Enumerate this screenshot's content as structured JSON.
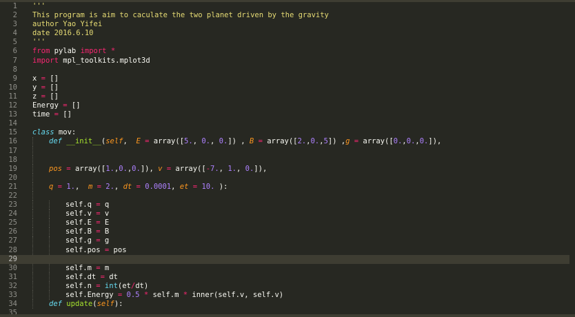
{
  "editor": {
    "theme_colors": {
      "background": "#272822",
      "text": "#f8f8f2",
      "string": "#e6db74",
      "keyword": "#f92672",
      "storage": "#66d9ef",
      "function_name": "#a6e22e",
      "parameter": "#fd971f",
      "number": "#ae81ff",
      "line_number": "#90908a",
      "current_line": "#3e3d32"
    },
    "current_line": 29,
    "lines": [
      {
        "n": "1",
        "tokens": [
          {
            "t": "'''",
            "c": "string"
          }
        ]
      },
      {
        "n": "2",
        "tokens": [
          {
            "t": "This program is aim to caculate the two planet driven by the gravity",
            "c": "string"
          }
        ]
      },
      {
        "n": "3",
        "tokens": [
          {
            "t": "author Yao Yifei",
            "c": "string"
          }
        ]
      },
      {
        "n": "4",
        "tokens": [
          {
            "t": "date 2016.6.10",
            "c": "string"
          }
        ]
      },
      {
        "n": "5",
        "tokens": [
          {
            "t": "'''",
            "c": "string"
          }
        ]
      },
      {
        "n": "6",
        "tokens": [
          {
            "t": "from",
            "c": "keyword"
          },
          {
            "t": " pylab ",
            "c": "name"
          },
          {
            "t": "import",
            "c": "keyword"
          },
          {
            "t": " ",
            "c": "name"
          },
          {
            "t": "*",
            "c": "op"
          }
        ]
      },
      {
        "n": "7",
        "tokens": [
          {
            "t": "import",
            "c": "keyword"
          },
          {
            "t": " mpl_toolkits.mplot3d",
            "c": "name"
          }
        ]
      },
      {
        "n": "8",
        "tokens": []
      },
      {
        "n": "9",
        "tokens": [
          {
            "t": "x ",
            "c": "name"
          },
          {
            "t": "=",
            "c": "op"
          },
          {
            "t": " []",
            "c": "name"
          }
        ]
      },
      {
        "n": "10",
        "tokens": [
          {
            "t": "y ",
            "c": "name"
          },
          {
            "t": "=",
            "c": "op"
          },
          {
            "t": " []",
            "c": "name"
          }
        ]
      },
      {
        "n": "11",
        "tokens": [
          {
            "t": "z ",
            "c": "name"
          },
          {
            "t": "=",
            "c": "op"
          },
          {
            "t": " []",
            "c": "name"
          }
        ]
      },
      {
        "n": "12",
        "tokens": [
          {
            "t": "Energy ",
            "c": "name"
          },
          {
            "t": "=",
            "c": "op"
          },
          {
            "t": " []",
            "c": "name"
          }
        ]
      },
      {
        "n": "13",
        "tokens": [
          {
            "t": "time ",
            "c": "name"
          },
          {
            "t": "=",
            "c": "op"
          },
          {
            "t": " []",
            "c": "name"
          }
        ]
      },
      {
        "n": "14",
        "tokens": []
      },
      {
        "n": "15",
        "tokens": [
          {
            "t": "class",
            "c": "storage"
          },
          {
            "t": " mov:",
            "c": "name"
          }
        ]
      },
      {
        "n": "16",
        "indent": 1,
        "tokens": [
          {
            "t": "def",
            "c": "storage"
          },
          {
            "t": " ",
            "c": "name"
          },
          {
            "t": "__init__",
            "c": "func"
          },
          {
            "t": "(",
            "c": "name"
          },
          {
            "t": "self",
            "c": "param"
          },
          {
            "t": ",  ",
            "c": "name"
          },
          {
            "t": "E",
            "c": "param"
          },
          {
            "t": " ",
            "c": "name"
          },
          {
            "t": "=",
            "c": "op"
          },
          {
            "t": " array([",
            "c": "name"
          },
          {
            "t": "5.",
            "c": "num"
          },
          {
            "t": ", ",
            "c": "name"
          },
          {
            "t": "0.",
            "c": "num"
          },
          {
            "t": ", ",
            "c": "name"
          },
          {
            "t": "0.",
            "c": "num"
          },
          {
            "t": "]) , ",
            "c": "name"
          },
          {
            "t": "B",
            "c": "param"
          },
          {
            "t": " ",
            "c": "name"
          },
          {
            "t": "=",
            "c": "op"
          },
          {
            "t": " array([",
            "c": "name"
          },
          {
            "t": "2.",
            "c": "num"
          },
          {
            "t": ",",
            "c": "name"
          },
          {
            "t": "0.",
            "c": "num"
          },
          {
            "t": ",",
            "c": "name"
          },
          {
            "t": "5",
            "c": "num"
          },
          {
            "t": "]) ,",
            "c": "name"
          },
          {
            "t": "g",
            "c": "param"
          },
          {
            "t": " ",
            "c": "name"
          },
          {
            "t": "=",
            "c": "op"
          },
          {
            "t": " array([",
            "c": "name"
          },
          {
            "t": "0.",
            "c": "num"
          },
          {
            "t": ",",
            "c": "name"
          },
          {
            "t": "0.",
            "c": "num"
          },
          {
            "t": ",",
            "c": "name"
          },
          {
            "t": "0.",
            "c": "num"
          },
          {
            "t": "]),",
            "c": "name"
          }
        ]
      },
      {
        "n": "17",
        "indent": 1,
        "tokens": []
      },
      {
        "n": "18",
        "indent": 1,
        "tokens": []
      },
      {
        "n": "19",
        "indent": 1,
        "tokens": [
          {
            "t": "pos",
            "c": "param"
          },
          {
            "t": " ",
            "c": "name"
          },
          {
            "t": "=",
            "c": "op"
          },
          {
            "t": " array([",
            "c": "name"
          },
          {
            "t": "1.",
            "c": "num"
          },
          {
            "t": ",",
            "c": "name"
          },
          {
            "t": "0.",
            "c": "num"
          },
          {
            "t": ",",
            "c": "name"
          },
          {
            "t": "0.",
            "c": "num"
          },
          {
            "t": "]), ",
            "c": "name"
          },
          {
            "t": "v",
            "c": "param"
          },
          {
            "t": " ",
            "c": "name"
          },
          {
            "t": "=",
            "c": "op"
          },
          {
            "t": " array([",
            "c": "name"
          },
          {
            "t": "-",
            "c": "op"
          },
          {
            "t": "7.",
            "c": "num"
          },
          {
            "t": ", ",
            "c": "name"
          },
          {
            "t": "1.",
            "c": "num"
          },
          {
            "t": ", ",
            "c": "name"
          },
          {
            "t": "0.",
            "c": "num"
          },
          {
            "t": "]),",
            "c": "name"
          }
        ]
      },
      {
        "n": "20",
        "indent": 1,
        "tokens": []
      },
      {
        "n": "21",
        "indent": 1,
        "tokens": [
          {
            "t": "q",
            "c": "param"
          },
          {
            "t": " ",
            "c": "name"
          },
          {
            "t": "=",
            "c": "op"
          },
          {
            "t": " ",
            "c": "name"
          },
          {
            "t": "1.",
            "c": "num"
          },
          {
            "t": ",  ",
            "c": "name"
          },
          {
            "t": "m",
            "c": "param"
          },
          {
            "t": " ",
            "c": "name"
          },
          {
            "t": "=",
            "c": "op"
          },
          {
            "t": " ",
            "c": "name"
          },
          {
            "t": "2.",
            "c": "num"
          },
          {
            "t": ", ",
            "c": "name"
          },
          {
            "t": "dt",
            "c": "param"
          },
          {
            "t": " ",
            "c": "name"
          },
          {
            "t": "=",
            "c": "op"
          },
          {
            "t": " ",
            "c": "name"
          },
          {
            "t": "0.0001",
            "c": "num"
          },
          {
            "t": ", ",
            "c": "name"
          },
          {
            "t": "et",
            "c": "param"
          },
          {
            "t": " ",
            "c": "name"
          },
          {
            "t": "=",
            "c": "op"
          },
          {
            "t": " ",
            "c": "name"
          },
          {
            "t": "10.",
            "c": "num"
          },
          {
            "t": " ):",
            "c": "name"
          }
        ]
      },
      {
        "n": "22",
        "indent": 1,
        "tokens": []
      },
      {
        "n": "23",
        "indent": 2,
        "tokens": [
          {
            "t": "self.q ",
            "c": "name"
          },
          {
            "t": "=",
            "c": "op"
          },
          {
            "t": " q",
            "c": "name"
          }
        ]
      },
      {
        "n": "24",
        "indent": 2,
        "tokens": [
          {
            "t": "self.v ",
            "c": "name"
          },
          {
            "t": "=",
            "c": "op"
          },
          {
            "t": " v",
            "c": "name"
          }
        ]
      },
      {
        "n": "25",
        "indent": 2,
        "tokens": [
          {
            "t": "self.E ",
            "c": "name"
          },
          {
            "t": "=",
            "c": "op"
          },
          {
            "t": " E",
            "c": "name"
          }
        ]
      },
      {
        "n": "26",
        "indent": 2,
        "tokens": [
          {
            "t": "self.B ",
            "c": "name"
          },
          {
            "t": "=",
            "c": "op"
          },
          {
            "t": " B",
            "c": "name"
          }
        ]
      },
      {
        "n": "27",
        "indent": 2,
        "tokens": [
          {
            "t": "self.g ",
            "c": "name"
          },
          {
            "t": "=",
            "c": "op"
          },
          {
            "t": " g",
            "c": "name"
          }
        ]
      },
      {
        "n": "28",
        "indent": 2,
        "tokens": [
          {
            "t": "self.pos ",
            "c": "name"
          },
          {
            "t": "=",
            "c": "op"
          },
          {
            "t": " pos",
            "c": "name"
          }
        ]
      },
      {
        "n": "29",
        "indent": 0,
        "tokens": []
      },
      {
        "n": "30",
        "indent": 2,
        "tokens": [
          {
            "t": "self.m ",
            "c": "name"
          },
          {
            "t": "=",
            "c": "op"
          },
          {
            "t": " m",
            "c": "name"
          }
        ]
      },
      {
        "n": "31",
        "indent": 2,
        "tokens": [
          {
            "t": "self.dt ",
            "c": "name"
          },
          {
            "t": "=",
            "c": "op"
          },
          {
            "t": " dt",
            "c": "name"
          }
        ]
      },
      {
        "n": "32",
        "indent": 2,
        "tokens": [
          {
            "t": "self.n ",
            "c": "name"
          },
          {
            "t": "=",
            "c": "op"
          },
          {
            "t": " ",
            "c": "name"
          },
          {
            "t": "int",
            "c": "builtin"
          },
          {
            "t": "(et",
            "c": "name"
          },
          {
            "t": "/",
            "c": "op"
          },
          {
            "t": "dt)",
            "c": "name"
          }
        ]
      },
      {
        "n": "33",
        "indent": 2,
        "tokens": [
          {
            "t": "self.Energy ",
            "c": "name"
          },
          {
            "t": "=",
            "c": "op"
          },
          {
            "t": " ",
            "c": "name"
          },
          {
            "t": "0.5",
            "c": "num"
          },
          {
            "t": " ",
            "c": "name"
          },
          {
            "t": "*",
            "c": "op"
          },
          {
            "t": " self.m ",
            "c": "name"
          },
          {
            "t": "*",
            "c": "op"
          },
          {
            "t": " inner(self.v, self.v)",
            "c": "name"
          }
        ]
      },
      {
        "n": "34",
        "indent": 1,
        "tokens": [
          {
            "t": "def",
            "c": "storage"
          },
          {
            "t": " ",
            "c": "name"
          },
          {
            "t": "update",
            "c": "func"
          },
          {
            "t": "(",
            "c": "name"
          },
          {
            "t": "self",
            "c": "param"
          },
          {
            "t": "):",
            "c": "name"
          }
        ]
      },
      {
        "n": "35",
        "tokens": []
      }
    ]
  }
}
